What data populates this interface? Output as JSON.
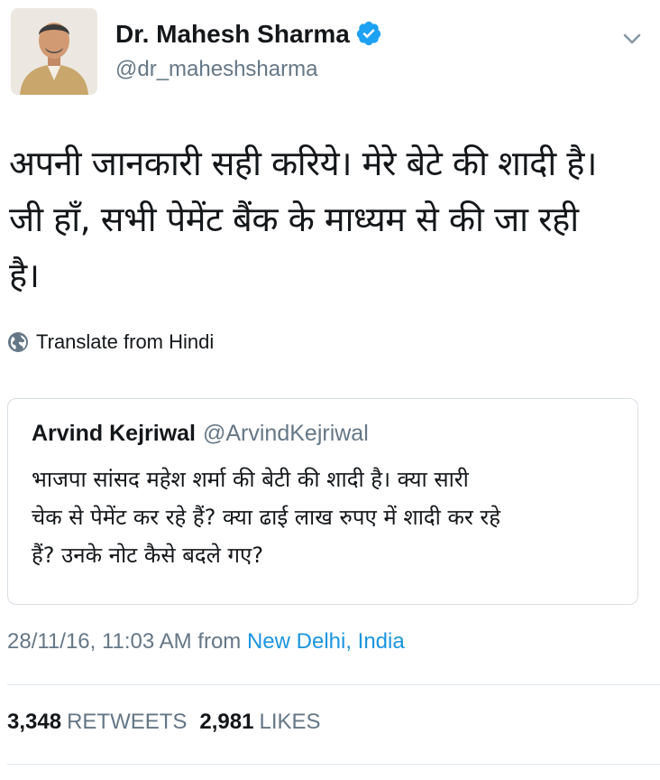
{
  "author": {
    "name": "Dr. Mahesh Sharma",
    "handle": "@dr_maheshsharma",
    "avatar_icon": "profile-photo"
  },
  "tweet": {
    "line1": "अपनी जानकारी सही करिये। मेरे बेटे की शादी है।",
    "line2": "जी हाँ, सभी पेमेंट बैंक के माध्यम से की जा रही",
    "line3": "है।",
    "translate_label": "Translate from Hindi"
  },
  "quoted_tweet": {
    "name": "Arvind Kejriwal",
    "handle": "@ArvindKejriwal",
    "line1": "भाजपा सांसद महेश शर्मा की बेटी की शादी है। क्या सारी",
    "line2": "चेक से पेमेंट कर रहे हैं? क्या ढाई लाख रुपए में शादी कर रहे",
    "line3": "हैं? उनके नोट कैसे बदले गए?"
  },
  "meta": {
    "timestamp": "28/11/16, 11:03 AM",
    "from_label": "from",
    "location": "New Delhi, India"
  },
  "stats": {
    "retweets_count": "3,348",
    "retweets_label": "RETWEETS",
    "likes_count": "2,981",
    "likes_label": "LIKES"
  },
  "colors": {
    "text": "#14171a",
    "secondary": "#657786",
    "link": "#1b95e0",
    "verified": "#1da1f2",
    "border": "#e1e8ed"
  }
}
